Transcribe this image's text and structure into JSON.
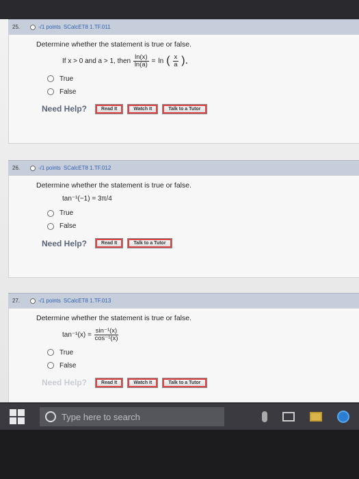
{
  "questions": [
    {
      "number": "25.",
      "points": "-/1 points",
      "code": "SCalcET8 1.TF.011",
      "prompt": "Determine whether the statement is true or false.",
      "formula": {
        "lead": "If x > 0 and a > 1, then",
        "lhs_num": "ln(x)",
        "lhs_den": "ln(a)",
        "eq": "=",
        "rhs_fn": "ln",
        "rhs_num": "x",
        "rhs_den": "a"
      },
      "options": [
        "True",
        "False"
      ],
      "help_label": "Need Help?",
      "buttons": [
        "Read It",
        "Watch It",
        "Talk to a Tutor"
      ]
    },
    {
      "number": "26.",
      "points": "-/1 points",
      "code": "SCalcET8 1.TF.012",
      "prompt": "Determine whether the statement is true or false.",
      "formula": "tan⁻¹(−1) = 3π/4",
      "options": [
        "True",
        "False"
      ],
      "help_label": "Need Help?",
      "buttons": [
        "Read It",
        "Talk to a Tutor"
      ]
    },
    {
      "number": "27.",
      "points": "-/1 points",
      "code": "SCalcET8 1.TF.013",
      "prompt": "Determine whether the statement is true or false.",
      "formula": {
        "lhs": "tan⁻¹(x) =",
        "num": "sin⁻¹(x)",
        "den": "cos⁻¹(x)"
      },
      "options": [
        "True",
        "False"
      ],
      "help_label": "Need Help?",
      "buttons": [
        "Read It",
        "Watch It",
        "Talk to a Tutor"
      ]
    }
  ],
  "taskbar": {
    "search_placeholder": "Type here to search"
  }
}
